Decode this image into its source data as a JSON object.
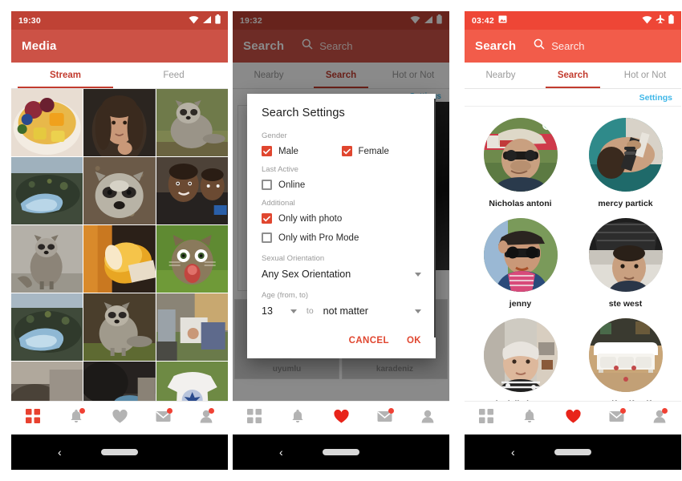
{
  "colors": {
    "statusbar_left": "#bf4235",
    "appbar_left": "#cc5246",
    "statusbar_right": "#ee4636",
    "appbar_right": "#f25c4a",
    "accent_red": "#c23b2e",
    "checkbox_red": "#e0462f",
    "link_blue": "#3fb7e8",
    "badge_red": "#f04134",
    "heart_red": "#e8241a",
    "online_green": "#22c55e"
  },
  "phones": [
    {
      "id": "media",
      "status": {
        "time": "19:30",
        "icons": [
          "wifi-icon",
          "signal-icon",
          "battery-icon"
        ]
      },
      "appbar": {
        "title": "Media"
      },
      "tabs": [
        {
          "label": "Stream",
          "active": true
        },
        {
          "label": "Feed",
          "active": false
        }
      ],
      "grid": {
        "items": [
          {
            "name": "fruit-bowl-photo"
          },
          {
            "name": "woman-portrait-photo"
          },
          {
            "name": "raccoon-sitting-photo"
          },
          {
            "name": "rock-pool-photo"
          },
          {
            "name": "raccoon-closeup-photo"
          },
          {
            "name": "two-men-selfie-photo"
          },
          {
            "name": "raccoon-standing-photo"
          },
          {
            "name": "beer-glass-photo"
          },
          {
            "name": "surprised-cat-photo"
          },
          {
            "name": "rock-pool-photo-2"
          },
          {
            "name": "raccoon-grass-photo"
          },
          {
            "name": "man-with-box-photo"
          },
          {
            "name": "rock-pool-photo-3"
          },
          {
            "name": "person-lying-photo"
          },
          {
            "name": "maple-leafs-tshirt-photo"
          }
        ]
      },
      "bottomnav": [
        {
          "name": "grid-icon",
          "active": true,
          "badge": false
        },
        {
          "name": "bell-icon",
          "active": false,
          "badge": true
        },
        {
          "name": "heart-icon",
          "active": false,
          "badge": false
        },
        {
          "name": "envelope-icon",
          "active": false,
          "badge": true
        },
        {
          "name": "person-icon",
          "active": false,
          "badge": true
        }
      ]
    },
    {
      "id": "search-settings-dialog",
      "status": {
        "time": "19:32",
        "icons": [
          "wifi-icon",
          "signal-icon",
          "battery-icon"
        ]
      },
      "appbar": {
        "title": "Search",
        "search_placeholder": "Search",
        "search_icon": "search-icon"
      },
      "tabs": [
        {
          "label": "Nearby",
          "active": false
        },
        {
          "label": "Search",
          "active": true
        },
        {
          "label": "Hot or Not",
          "active": false
        }
      ],
      "background": {
        "settings_link": "Settings",
        "tiles": [
          {
            "label": "uyumlu"
          },
          {
            "label": "karadeniz"
          }
        ]
      },
      "dialog": {
        "title": "Search Settings",
        "sections": [
          {
            "label": "Gender",
            "checkboxes": [
              {
                "label": "Male",
                "checked": true
              },
              {
                "label": "Female",
                "checked": true
              }
            ]
          },
          {
            "label": "Last Active",
            "checkboxes": [
              {
                "label": "Online",
                "checked": false
              }
            ]
          },
          {
            "label": "Additional",
            "checkboxes": [
              {
                "label": "Only with photo",
                "checked": true
              },
              {
                "label": "Only with Pro Mode",
                "checked": false
              }
            ]
          }
        ],
        "orientation": {
          "label": "Sexual Orientation",
          "value": "Any Sex Orientation"
        },
        "age": {
          "label": "Age (from, to)",
          "from": "13",
          "separator": "to",
          "to": "not matter"
        },
        "actions": {
          "cancel": "CANCEL",
          "ok": "OK"
        }
      },
      "bottomnav": [
        {
          "name": "grid-icon",
          "active": false,
          "badge": false
        },
        {
          "name": "bell-icon",
          "active": false,
          "badge": false
        },
        {
          "name": "heart-icon",
          "active": true,
          "badge": false
        },
        {
          "name": "envelope-icon",
          "active": false,
          "badge": true
        },
        {
          "name": "person-icon",
          "active": false,
          "badge": false
        }
      ]
    },
    {
      "id": "search-results",
      "status": {
        "time": "03:42",
        "icons": [
          "image-icon",
          "wifi-icon",
          "airplane-icon",
          "battery-icon"
        ]
      },
      "appbar": {
        "title": "Search",
        "search_placeholder": "Search",
        "search_icon": "search-icon"
      },
      "tabs": [
        {
          "label": "Nearby",
          "active": false
        },
        {
          "label": "Search",
          "active": true
        },
        {
          "label": "Hot or Not",
          "active": false
        }
      ],
      "settings_link": "Settings",
      "users": [
        {
          "name": "Nicholas antoni",
          "avatar": "man-cap-sunglasses-avatar",
          "online": true
        },
        {
          "name": "mercy partick",
          "avatar": "woman-lying-avatar",
          "online": false
        },
        {
          "name": "jenny",
          "avatar": "woman-sunglasses-scarf-avatar",
          "online": false
        },
        {
          "name": "ste west",
          "avatar": "man-dark-hoodie-avatar",
          "online": false
        },
        {
          "name": "danielle lucas",
          "avatar": "older-woman-avatar",
          "online": false
        },
        {
          "name": "asdfasdfasdf",
          "avatar": "white-sofa-avatar",
          "online": false
        }
      ],
      "bottomnav": [
        {
          "name": "grid-icon",
          "active": false,
          "badge": false
        },
        {
          "name": "bell-icon",
          "active": false,
          "badge": false
        },
        {
          "name": "heart-icon",
          "active": true,
          "badge": false
        },
        {
          "name": "envelope-icon",
          "active": false,
          "badge": true
        },
        {
          "name": "person-icon",
          "active": false,
          "badge": true
        }
      ]
    }
  ]
}
